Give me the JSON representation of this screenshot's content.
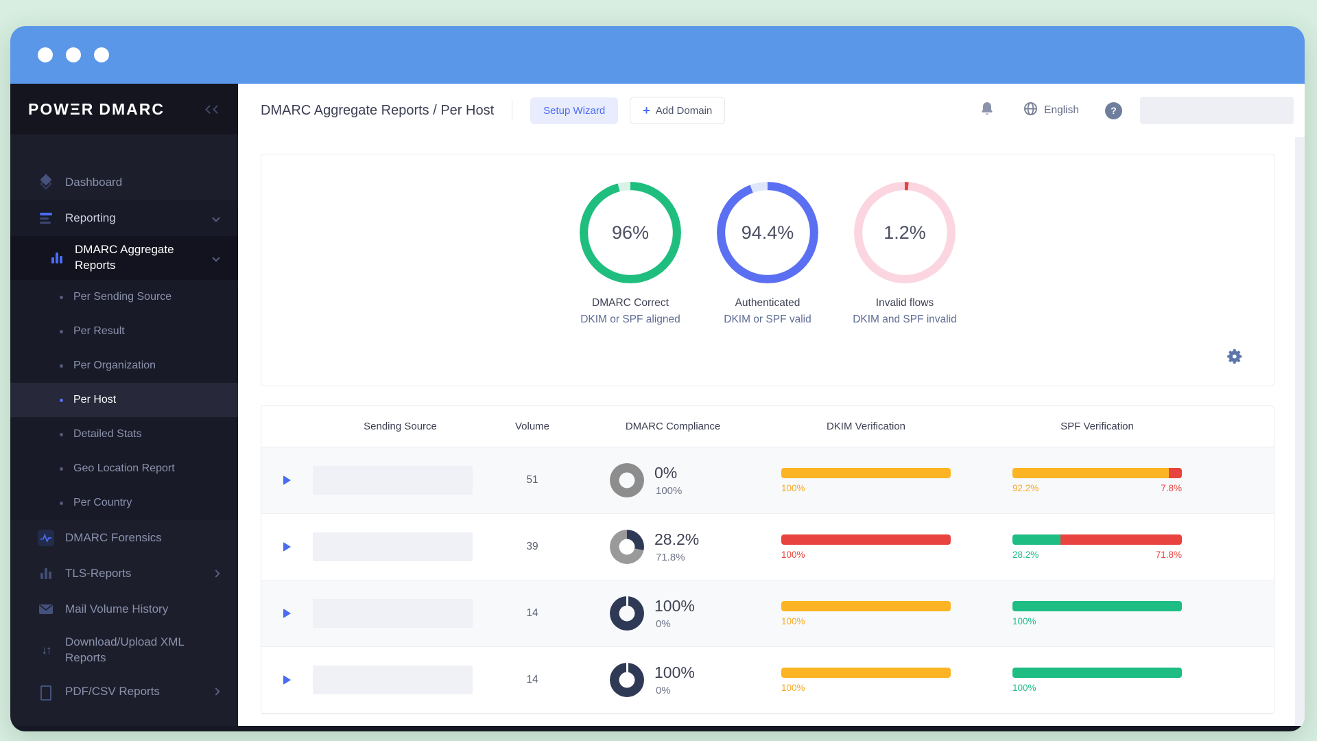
{
  "sidebar": {
    "logo": {
      "pre": "POW",
      "e": "Ξ",
      "r": "R",
      "brand": "DMARC"
    },
    "items": [
      {
        "label": "Dashboard"
      },
      {
        "label": "Reporting"
      },
      {
        "label": "DMARC Aggregate Reports"
      },
      {
        "label": "Per Sending Source"
      },
      {
        "label": "Per Result"
      },
      {
        "label": "Per Organization"
      },
      {
        "label": "Per Host"
      },
      {
        "label": "Detailed Stats"
      },
      {
        "label": "Geo Location Report"
      },
      {
        "label": "Per Country"
      },
      {
        "label": "DMARC Forensics"
      },
      {
        "label": "TLS-Reports"
      },
      {
        "label": "Mail Volume History"
      },
      {
        "label": "Download/Upload XML Reports"
      },
      {
        "label": "PDF/CSV Reports"
      }
    ]
  },
  "header": {
    "title": "DMARC Aggregate Reports / Per Host",
    "setup_wizard": "Setup Wizard",
    "add_domain": "Add Domain",
    "plus": "+",
    "language": "English",
    "help": "?"
  },
  "chart_data": {
    "type": "donut",
    "donuts": [
      {
        "value": "96%",
        "pct": 96,
        "ring_color": "#1fbe7e",
        "track_color": "#d9f3e8",
        "title": "DMARC Correct",
        "subtitle": "DKIM or SPF aligned"
      },
      {
        "value": "94.4%",
        "pct": 94.4,
        "ring_color": "#5b6ff2",
        "track_color": "#dfe5fb",
        "title": "Authenticated",
        "subtitle": "DKIM or SPF valid"
      },
      {
        "value": "1.2%",
        "pct": 1.2,
        "ring_color": "#e8433e",
        "track_color": "#fbd5e0",
        "title": "Invalid flows",
        "subtitle": "DKIM and SPF invalid"
      }
    ]
  },
  "table": {
    "headers": [
      "Sending Source",
      "Volume",
      "DMARC Compliance",
      "DKIM Verification",
      "SPF Verification"
    ],
    "rows": [
      {
        "volume": "51",
        "compliance": {
          "main": "0%",
          "sub": "100%",
          "fill_color": "#2e3a55",
          "rest_color": "#8d8d8d"
        },
        "dkim": {
          "w1": "100%",
          "c1": "#fcb424",
          "w2": "0%",
          "c2": "transparent",
          "left_label": "100%",
          "left_color": "#f7a922",
          "right_label": "",
          "right_color": "transparent"
        },
        "spf": {
          "w1": "92.2%",
          "c1": "#fcb424",
          "w2": "7.8%",
          "c2": "#e8433e",
          "left_label": "92.2%",
          "left_color": "#f7a922",
          "right_label": "7.8%",
          "right_color": "#e8433e"
        }
      },
      {
        "volume": "39",
        "compliance": {
          "main": "28.2%",
          "sub": "71.8%",
          "fill_color": "#2e3a55",
          "rest_color": "#9a9a9a"
        },
        "dkim": {
          "w1": "100%",
          "c1": "#e8433e",
          "w2": "0%",
          "c2": "transparent",
          "left_label": "100%",
          "left_color": "#e8433e",
          "right_label": "",
          "right_color": "transparent"
        },
        "spf": {
          "w1": "28.2%",
          "c1": "#1dbd84",
          "w2": "71.8%",
          "c2": "#e8433e",
          "left_label": "28.2%",
          "left_color": "#1dbd84",
          "right_label": "71.8%",
          "right_color": "#e8433e"
        }
      },
      {
        "volume": "14",
        "compliance": {
          "main": "100%",
          "sub": "0%",
          "fill_color": "#2e3a55",
          "rest_color": "#8d8d8d"
        },
        "dkim": {
          "w1": "100%",
          "c1": "#fcb424",
          "w2": "0%",
          "c2": "transparent",
          "left_label": "100%",
          "left_color": "#f7a922",
          "right_label": "",
          "right_color": "transparent"
        },
        "spf": {
          "w1": "100%",
          "c1": "#1dbd84",
          "w2": "0%",
          "c2": "transparent",
          "left_label": "100%",
          "left_color": "#1dbd84",
          "right_label": "",
          "right_color": "transparent"
        }
      },
      {
        "volume": "14",
        "compliance": {
          "main": "100%",
          "sub": "0%",
          "fill_color": "#2e3a55",
          "rest_color": "#8d8d8d"
        },
        "dkim": {
          "w1": "100%",
          "c1": "#fcb424",
          "w2": "0%",
          "c2": "transparent",
          "left_label": "100%",
          "left_color": "#f7a922",
          "right_label": "",
          "right_color": "transparent"
        },
        "spf": {
          "w1": "100%",
          "c1": "#1dbd84",
          "w2": "0%",
          "c2": "transparent",
          "left_label": "100%",
          "left_color": "#1dbd84",
          "right_label": "",
          "right_color": "transparent"
        }
      }
    ]
  }
}
